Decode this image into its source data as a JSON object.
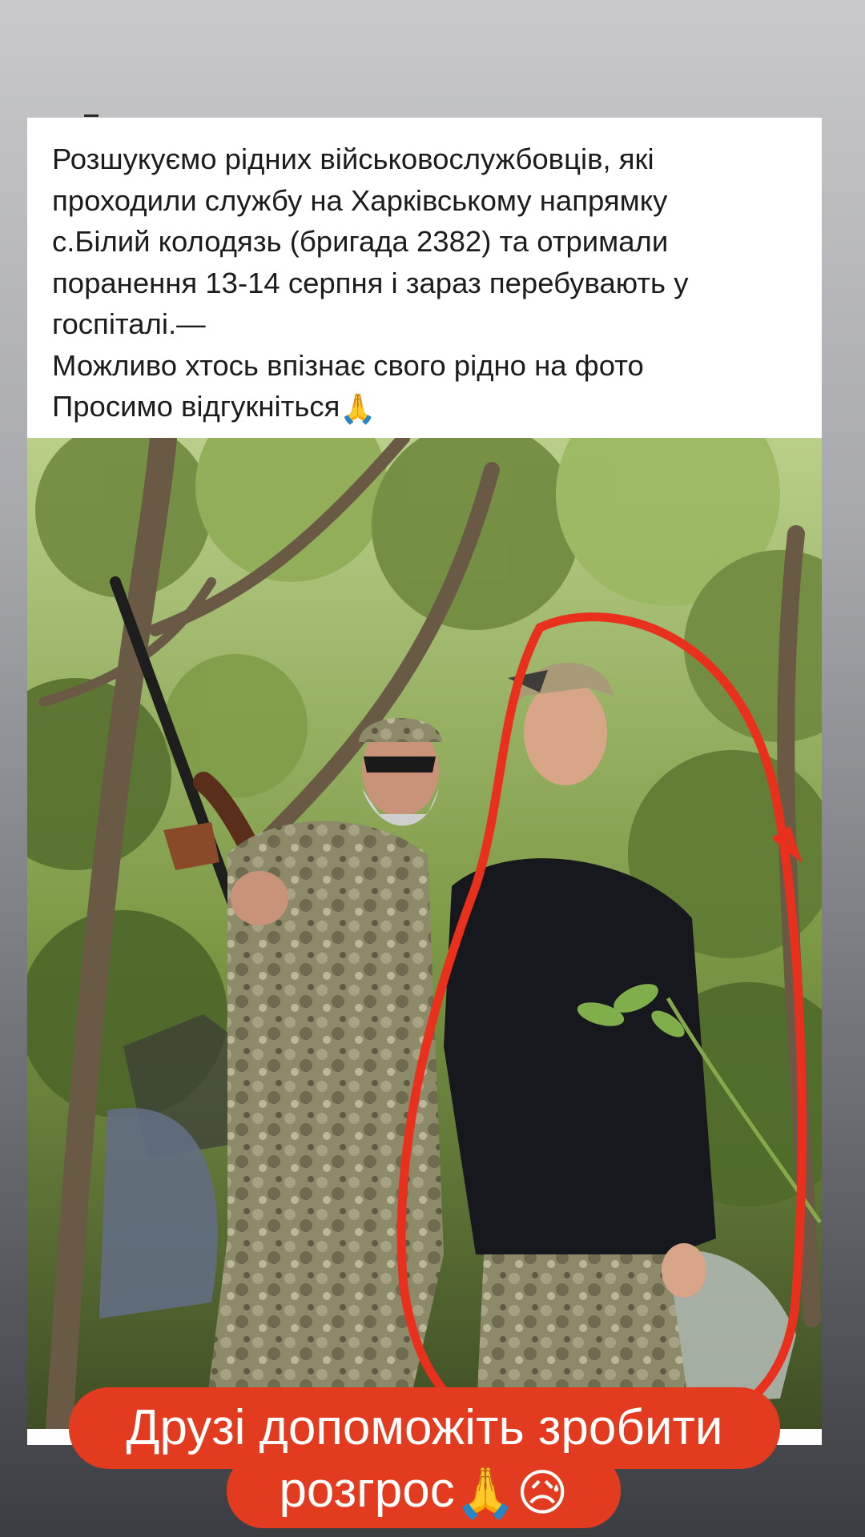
{
  "post": {
    "text_lines": [
      "Розшукуємо рідних військовослужбовців, які",
      "проходили службу на Харківському напрямку",
      "с.Білий колодязь (бригада 2382) та отримали",
      "поранення 13-14 серпня і зараз перебувають у",
      "госпіталі.—",
      "Можливо хтось впізнає свого рідно на фото",
      "Просимо відгукніться"
    ],
    "emoji_pray": "🙏"
  },
  "caption": {
    "line1": "Друзі допоможіть зробити",
    "line2": "розгрос",
    "emoji_pray": "🙏",
    "emoji_sad": "😥"
  },
  "colors": {
    "caption_bg": "#e33b1f",
    "highlight_circle": "#e8301c",
    "foliage": "#6f8a3e"
  }
}
